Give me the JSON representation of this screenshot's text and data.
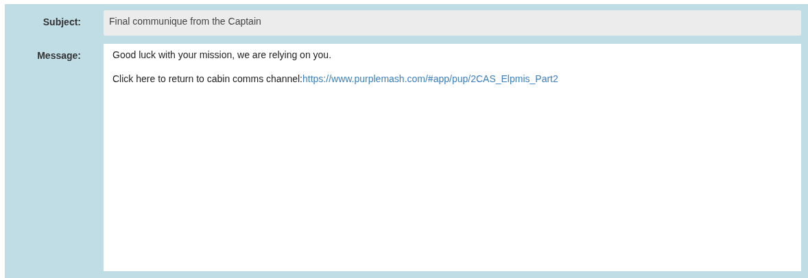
{
  "subject": {
    "label": "Subject:",
    "value": "Final communique from the Captain"
  },
  "message": {
    "label": "Message:",
    "paragraphs": [
      {
        "text": "Good luck with your mission, we are relying on you."
      },
      {
        "text": "Click here to return to cabin comms channel:",
        "link": "https://www.purplemash.com/#app/pup/2CAS_Elpmis_Part2"
      }
    ]
  }
}
